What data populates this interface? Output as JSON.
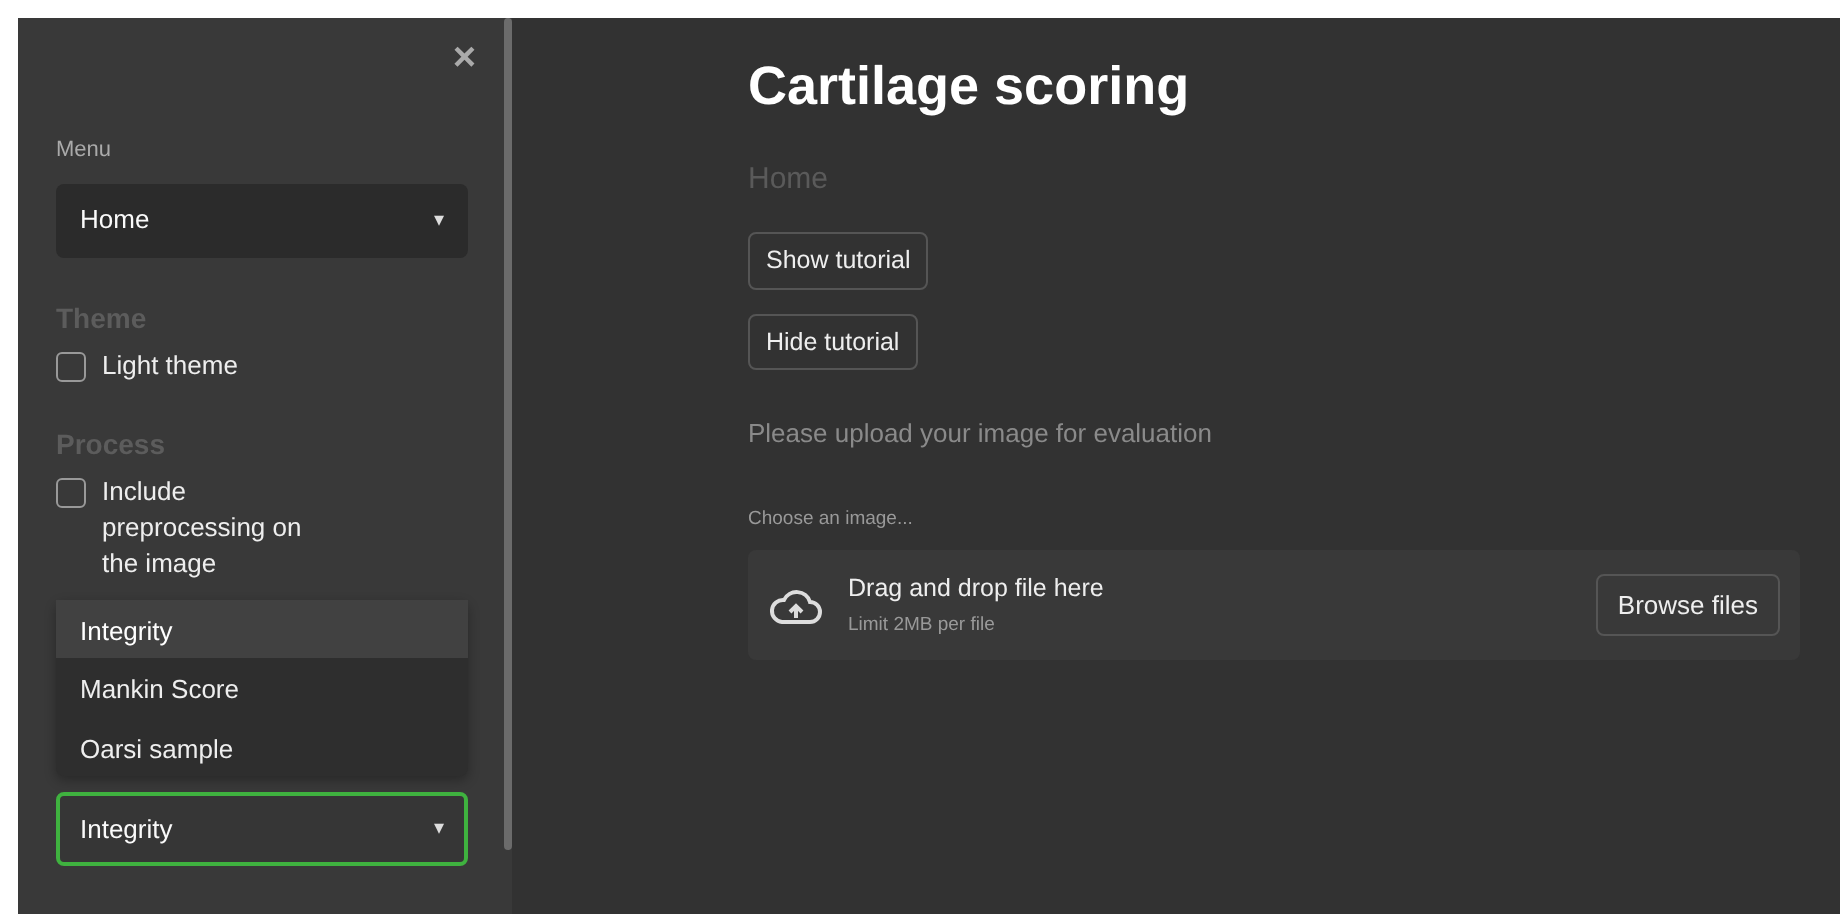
{
  "sidebar": {
    "close": "×",
    "menu": {
      "label": "Menu",
      "value": "Home",
      "caret": "▾"
    },
    "sections": [
      {
        "heading": "Theme",
        "checkboxes": [
          {
            "label": "Light theme",
            "checked": false
          }
        ]
      },
      {
        "heading": "Process",
        "checkboxes": [
          {
            "label": "Include preprocessing on the image",
            "checked": false
          }
        ]
      }
    ],
    "model_select": {
      "value": "Integrity",
      "caret": "▾",
      "focused": true,
      "options": [
        {
          "label": "Integrity",
          "selected": true
        },
        {
          "label": "Mankin Score",
          "selected": false
        },
        {
          "label": "Oarsi sample",
          "selected": false
        }
      ]
    }
  },
  "main": {
    "title": "Cartilage scoring",
    "subtitle": "Home",
    "buttons": [
      "Show tutorial",
      "Hide tutorial"
    ],
    "instruction": "Please upload your image for evaluation",
    "uploader": {
      "label": "Choose an image...",
      "drop_text": "Drag and drop file here",
      "limit": "Limit 2MB per file",
      "button": "Browse files"
    }
  }
}
